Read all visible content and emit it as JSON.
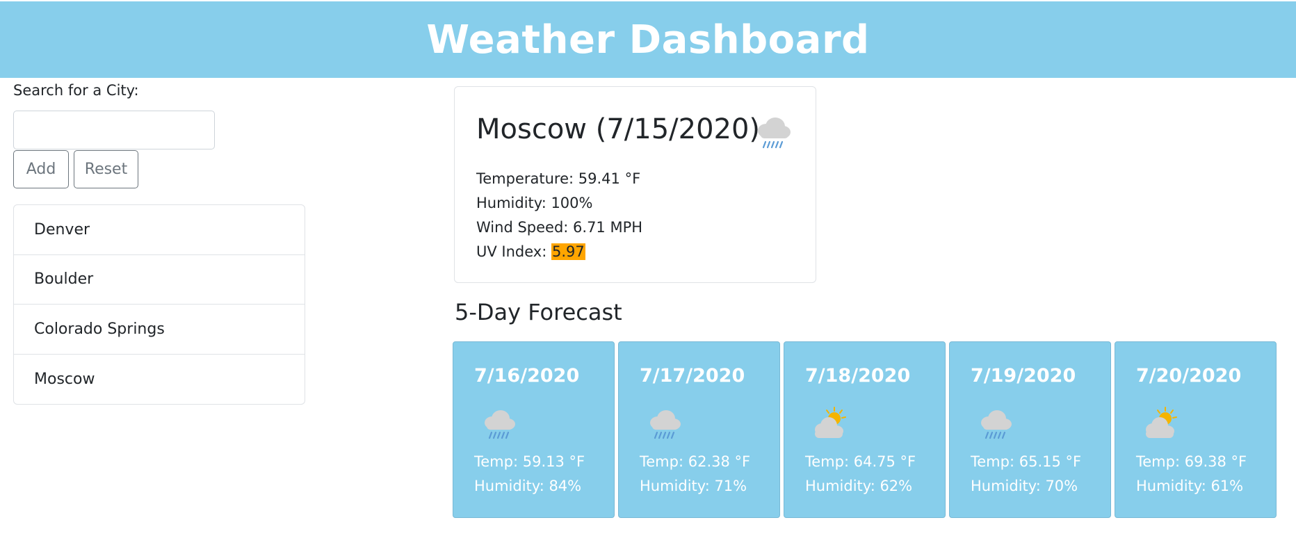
{
  "header": {
    "title": "Weather Dashboard"
  },
  "sidebar": {
    "search_label": "Search for a City:",
    "search_value": "",
    "search_placeholder": "",
    "add_label": "Add",
    "reset_label": "Reset",
    "cities": [
      "Denver",
      "Boulder",
      "Colorado Springs",
      "Moscow"
    ]
  },
  "current": {
    "title": "Moscow (7/15/2020)",
    "icon": "rain-cloud-icon",
    "temperature": "Temperature: 59.41 °F",
    "humidity": "Humidity: 100%",
    "wind": "Wind Speed: 6.71 MPH",
    "uv_label": "UV Index: ",
    "uv_value": "5.97",
    "uv_color": "#ffa500"
  },
  "forecast": {
    "title": "5-Day Forecast",
    "days": [
      {
        "date": "7/16/2020",
        "icon": "rain-cloud-icon",
        "temp": "Temp: 59.13 °F",
        "humidity": "Humidity: 84%"
      },
      {
        "date": "7/17/2020",
        "icon": "rain-cloud-icon",
        "temp": "Temp: 62.38 °F",
        "humidity": "Humidity: 71%"
      },
      {
        "date": "7/18/2020",
        "icon": "sun-cloud-icon",
        "temp": "Temp: 64.75 °F",
        "humidity": "Humidity: 62%"
      },
      {
        "date": "7/19/2020",
        "icon": "rain-cloud-icon",
        "temp": "Temp: 65.15 °F",
        "humidity": "Humidity: 70%"
      },
      {
        "date": "7/20/2020",
        "icon": "sun-cloud-icon",
        "temp": "Temp: 69.38 °F",
        "humidity": "Humidity: 61%"
      }
    ]
  },
  "colors": {
    "header_bg": "#87ceeb",
    "card_bg": "#87ceeb",
    "uv_moderate": "#ffa500"
  }
}
